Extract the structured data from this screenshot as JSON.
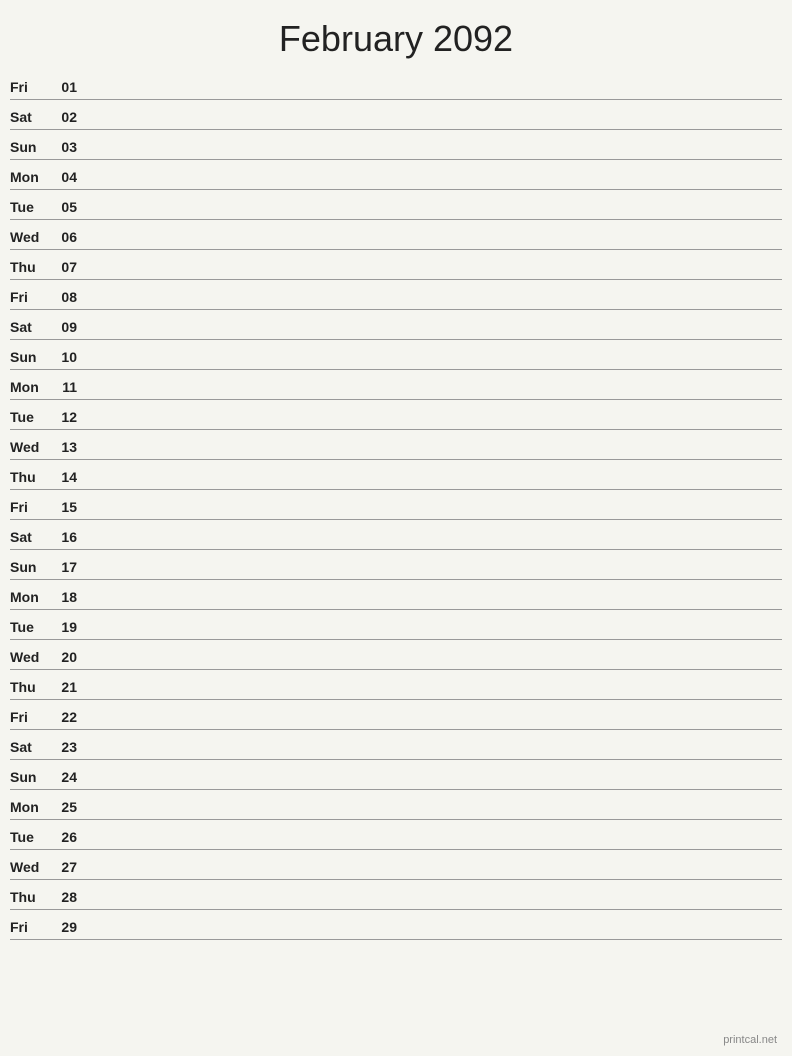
{
  "header": {
    "title": "February 2092"
  },
  "days": [
    {
      "name": "Fri",
      "num": "01"
    },
    {
      "name": "Sat",
      "num": "02"
    },
    {
      "name": "Sun",
      "num": "03"
    },
    {
      "name": "Mon",
      "num": "04"
    },
    {
      "name": "Tue",
      "num": "05"
    },
    {
      "name": "Wed",
      "num": "06"
    },
    {
      "name": "Thu",
      "num": "07"
    },
    {
      "name": "Fri",
      "num": "08"
    },
    {
      "name": "Sat",
      "num": "09"
    },
    {
      "name": "Sun",
      "num": "10"
    },
    {
      "name": "Mon",
      "num": "11"
    },
    {
      "name": "Tue",
      "num": "12"
    },
    {
      "name": "Wed",
      "num": "13"
    },
    {
      "name": "Thu",
      "num": "14"
    },
    {
      "name": "Fri",
      "num": "15"
    },
    {
      "name": "Sat",
      "num": "16"
    },
    {
      "name": "Sun",
      "num": "17"
    },
    {
      "name": "Mon",
      "num": "18"
    },
    {
      "name": "Tue",
      "num": "19"
    },
    {
      "name": "Wed",
      "num": "20"
    },
    {
      "name": "Thu",
      "num": "21"
    },
    {
      "name": "Fri",
      "num": "22"
    },
    {
      "name": "Sat",
      "num": "23"
    },
    {
      "name": "Sun",
      "num": "24"
    },
    {
      "name": "Mon",
      "num": "25"
    },
    {
      "name": "Tue",
      "num": "26"
    },
    {
      "name": "Wed",
      "num": "27"
    },
    {
      "name": "Thu",
      "num": "28"
    },
    {
      "name": "Fri",
      "num": "29"
    }
  ],
  "footer": {
    "text": "printcal.net"
  }
}
